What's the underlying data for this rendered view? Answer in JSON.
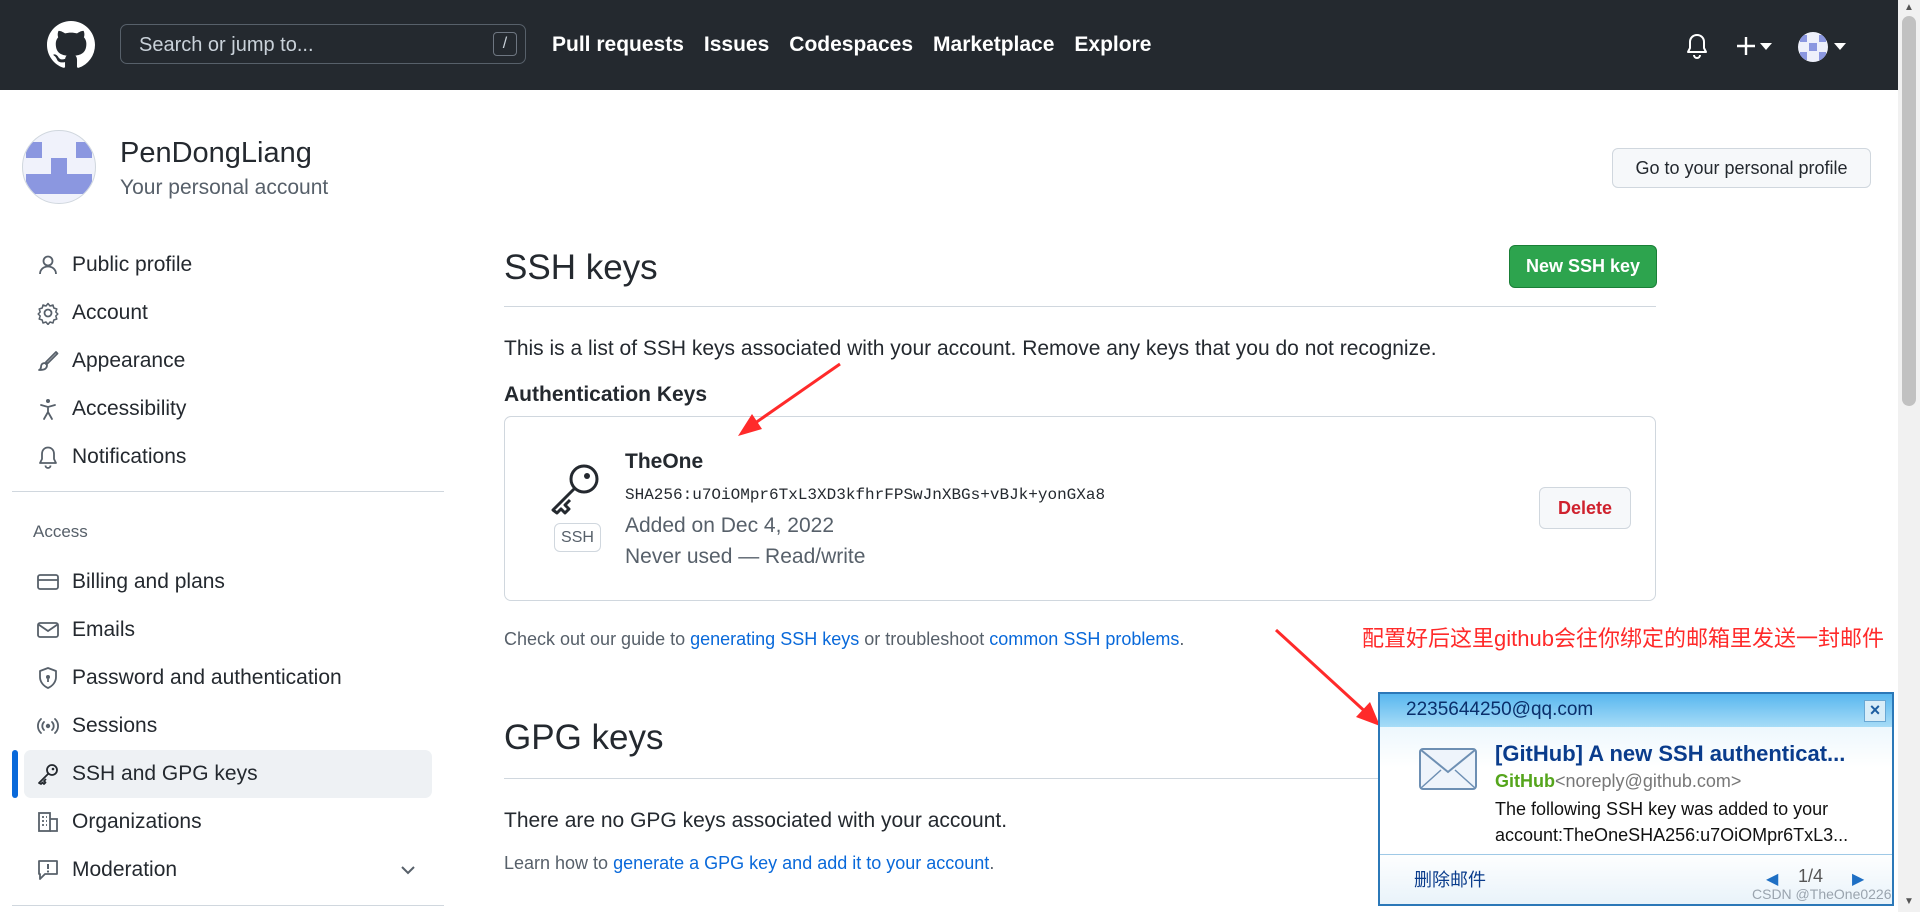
{
  "header": {
    "search_placeholder": "Search or jump to...",
    "search_shortcut": "/",
    "nav": [
      "Pull requests",
      "Issues",
      "Codespaces",
      "Marketplace",
      "Explore"
    ]
  },
  "user": {
    "name": "PenDongLiang",
    "subtitle": "Your personal account",
    "profile_button": "Go to your personal profile"
  },
  "sidebar": {
    "items": [
      {
        "label": "Public profile",
        "icon": "person-icon"
      },
      {
        "label": "Account",
        "icon": "gear-icon"
      },
      {
        "label": "Appearance",
        "icon": "paintbrush-icon"
      },
      {
        "label": "Accessibility",
        "icon": "accessibility-icon"
      },
      {
        "label": "Notifications",
        "icon": "bell-icon"
      }
    ],
    "access_heading": "Access",
    "access_items": [
      {
        "label": "Billing and plans",
        "icon": "credit-card-icon"
      },
      {
        "label": "Emails",
        "icon": "mail-icon"
      },
      {
        "label": "Password and authentication",
        "icon": "shield-lock-icon"
      },
      {
        "label": "Sessions",
        "icon": "broadcast-icon"
      },
      {
        "label": "SSH and GPG keys",
        "icon": "key-icon",
        "active": true
      },
      {
        "label": "Organizations",
        "icon": "organization-icon"
      },
      {
        "label": "Moderation",
        "icon": "report-icon"
      }
    ]
  },
  "ssh": {
    "title": "SSH keys",
    "new_button": "New SSH key",
    "description": "This is a list of SSH keys associated with your account. Remove any keys that you do not recognize.",
    "auth_heading": "Authentication Keys",
    "key": {
      "name": "TheOne",
      "fingerprint": "SHA256:u7OiOMpr6TxL3XD3kfhrFPSwJnXBGs+vBJk+yonGXa8",
      "added": "Added on Dec 4, 2022",
      "usage": "Never used — Read/write",
      "badge": "SSH",
      "delete_button": "Delete"
    },
    "guide": {
      "prefix": "Check out our guide to ",
      "link1": "generating SSH keys",
      "middle": " or troubleshoot ",
      "link2": "common SSH problems",
      "suffix": "."
    }
  },
  "gpg": {
    "title": "GPG keys",
    "empty": "There are no GPG keys associated with your account.",
    "learn_prefix": "Learn how to ",
    "learn_link": "generate a GPG key and add it to your account",
    "learn_suffix": "."
  },
  "annotation": "配置好后这里github会往你绑定的邮箱里发送一封邮件",
  "popup": {
    "account": "2235644250@qq.com",
    "subject": "[GitHub] A new SSH authenticat...",
    "from_name": "GitHub",
    "from_email": "<noreply@github.com>",
    "body": "The following SSH key was added to your account:TheOneSHA256:u7OiOMpr6TxL3...",
    "delete": "删除邮件",
    "page": "1/4"
  },
  "watermark": "CSDN @TheOne0226",
  "colors": {
    "header_bg": "#24292f",
    "accent_blue": "#0969da",
    "primary_green": "#2da44e",
    "danger_red": "#cf222e",
    "annotation_red": "#ff2a2a"
  }
}
